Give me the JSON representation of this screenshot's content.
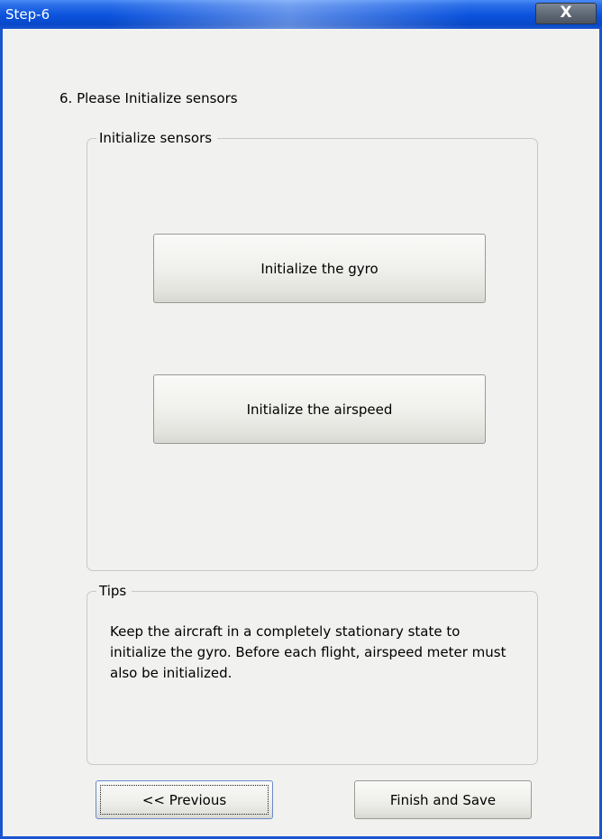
{
  "window": {
    "title": "Step-6",
    "close_label": "X"
  },
  "step": {
    "heading": "6. Please Initialize sensors"
  },
  "sensors_group": {
    "legend": "Initialize sensors",
    "gyro_button": "Initialize the gyro",
    "airspeed_button": "Initialize the airspeed"
  },
  "tips_group": {
    "legend": "Tips",
    "text": "Keep the aircraft in a completely stationary state to initialize the gyro. Before each flight, airspeed meter must also be initialized."
  },
  "footer": {
    "previous_label": "<< Previous",
    "finish_label": "Finish and Save"
  },
  "colors": {
    "titlebar": "#0a52dc",
    "window_bg": "#f1f1ef",
    "close_button": "#5e6874"
  },
  "icons": {
    "close": "close-icon"
  }
}
